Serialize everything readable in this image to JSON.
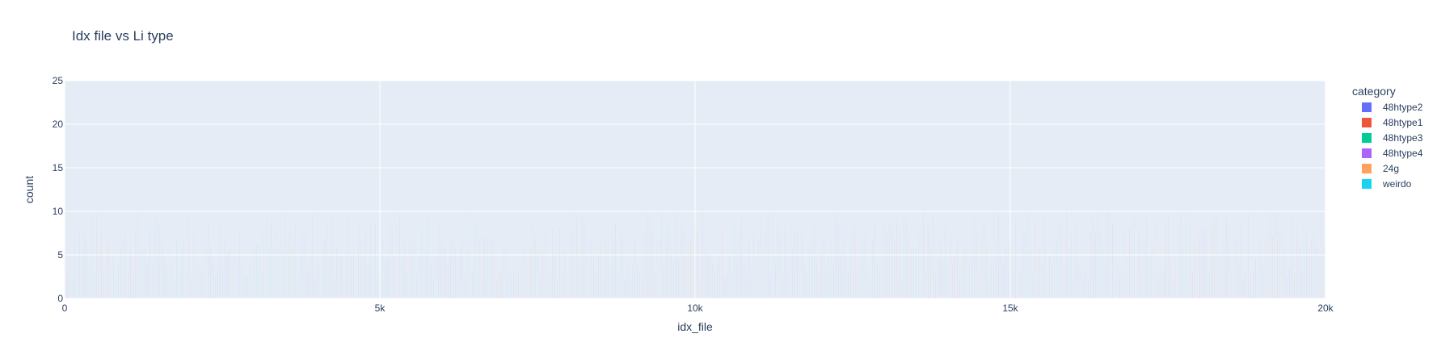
{
  "chart_data": {
    "type": "bar",
    "title": "Idx file vs Li type",
    "xlabel": "idx_file",
    "ylabel": "count",
    "xlim": [
      0,
      20000
    ],
    "ylim": [
      0,
      25
    ],
    "x_ticks": [
      {
        "value": 0,
        "label": "0"
      },
      {
        "value": 5000,
        "label": "5k"
      },
      {
        "value": 10000,
        "label": "10k"
      },
      {
        "value": 15000,
        "label": "15k"
      },
      {
        "value": 20000,
        "label": "20k"
      }
    ],
    "y_ticks": [
      {
        "value": 0,
        "label": "0"
      },
      {
        "value": 5,
        "label": "5"
      },
      {
        "value": 10,
        "label": "10"
      },
      {
        "value": 15,
        "label": "15"
      },
      {
        "value": 20,
        "label": "20"
      },
      {
        "value": 25,
        "label": "25"
      }
    ],
    "legend": {
      "title": "category",
      "placement": "right",
      "items": [
        {
          "name": "48htype2",
          "color": "#636efa"
        },
        {
          "name": "48htype1",
          "color": "#EF553B"
        },
        {
          "name": "48htype3",
          "color": "#00cc96"
        },
        {
          "name": "48htype4",
          "color": "#ab63fa"
        },
        {
          "name": "24g",
          "color": "#FFA15A"
        },
        {
          "name": "weirdo",
          "color": "#19d3f3"
        }
      ]
    },
    "grid": true,
    "plot_bgcolor": "#e5ecf6"
  }
}
